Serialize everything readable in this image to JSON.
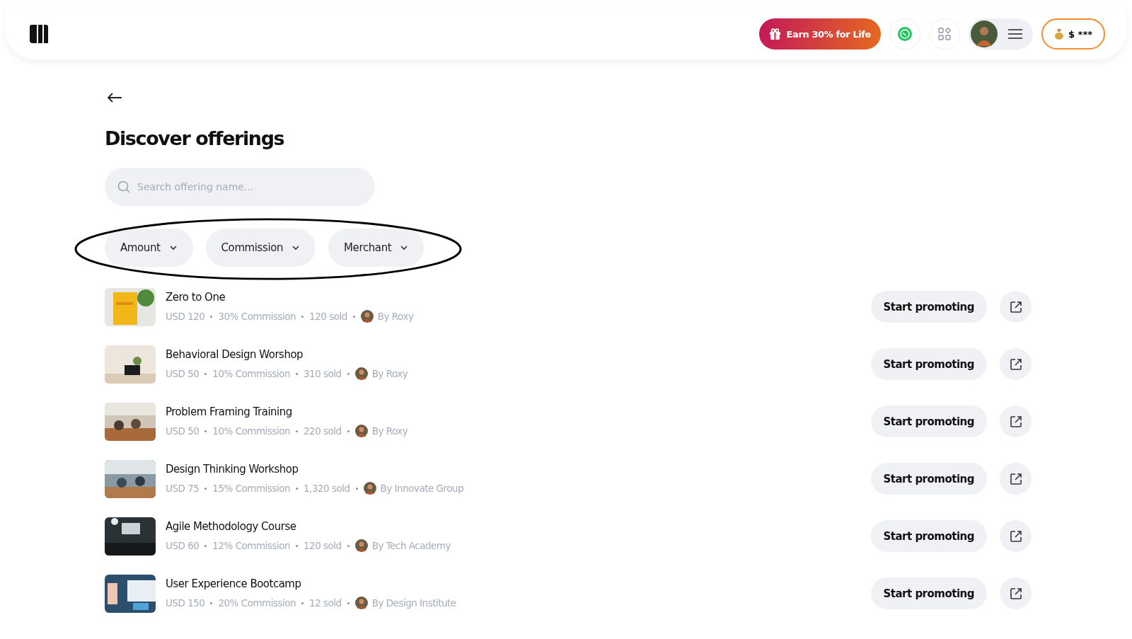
{
  "header": {
    "promo_button": "Earn 30% for Life",
    "balance": "$ ***"
  },
  "page": {
    "title": "Discover offerings",
    "search": {
      "placeholder": "Search offering name..."
    },
    "filters": [
      {
        "label": "Amount"
      },
      {
        "label": "Commission"
      },
      {
        "label": "Merchant"
      }
    ],
    "annotation": {
      "kind": "ellipse"
    },
    "offerings": [
      {
        "title": "Zero to One",
        "price": "USD 120",
        "commission": "30% Commission",
        "sold": "120 sold",
        "merchant": "By Roxy",
        "action": "Start promoting"
      },
      {
        "title": "Behavioral Design Worshop",
        "price": "USD 50",
        "commission": "10% Commission",
        "sold": "310 sold",
        "merchant": "By Roxy",
        "action": "Start promoting"
      },
      {
        "title": "Problem Framing Training",
        "price": "USD 50",
        "commission": "10% Commission",
        "sold": "220 sold",
        "merchant": "By Roxy",
        "action": "Start promoting"
      },
      {
        "title": "Design Thinking Workshop",
        "price": "USD 75",
        "commission": "15% Commission",
        "sold": "1,320 sold",
        "merchant": "By Innovate Group",
        "action": "Start promoting"
      },
      {
        "title": "Agile Methodology Course",
        "price": "USD 60",
        "commission": "12% Commission",
        "sold": "120 sold",
        "merchant": "By Tech Academy",
        "action": "Start promoting"
      },
      {
        "title": "User Experience Bootcamp",
        "price": "USD 150",
        "commission": "20% Commission",
        "sold": "12 sold",
        "merchant": "By Design Institute",
        "action": "Start promoting"
      }
    ]
  }
}
